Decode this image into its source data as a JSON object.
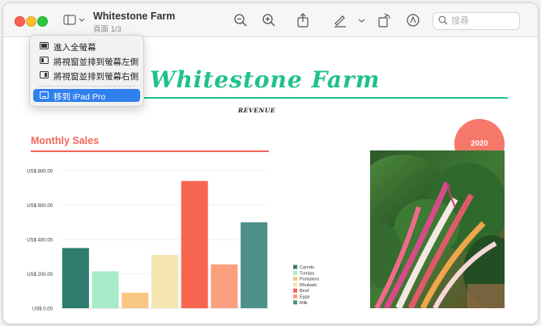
{
  "window": {
    "title": "Whitestone Farm",
    "page_indicator": "頁面 1/3"
  },
  "toolbar": {
    "icons": [
      "sidebar-icon",
      "chevron-down-icon",
      "zoom-out-icon",
      "zoom-in-icon",
      "share-icon",
      "markup-pen-icon",
      "chevron-down-icon",
      "rotate-icon",
      "annotate-icon",
      "search-icon"
    ],
    "search_placeholder": "搜尋"
  },
  "window_menu": {
    "items": [
      {
        "label": "進入全螢幕",
        "icon": "fullscreen-icon"
      },
      {
        "label": "將視窗並排到螢幕左側",
        "icon": "tile-left-icon"
      },
      {
        "label": "將視窗並排到螢幕右側",
        "icon": "tile-right-icon"
      },
      {
        "label": "移到 iPad Pro",
        "icon": "ipad-icon",
        "selected": true
      }
    ]
  },
  "document": {
    "title": "Whitestone Farm",
    "subtitle": "REVENUE",
    "section_title": "Monthly Sales",
    "badge": "2020",
    "photo": "chard-vegetables-photo"
  },
  "colors": {
    "accent_green": "#1fc28a",
    "accent_coral": "#f4655a",
    "badge": "#f6786a",
    "menu_selected": "#2f80ed"
  },
  "chart_data": {
    "type": "bar",
    "categories": [
      "Carrots",
      "Turnips",
      "Pumpkins",
      "Rhubarb",
      "Beef",
      "Eggs",
      "Milk"
    ],
    "values": [
      350,
      215,
      90,
      310,
      740,
      255,
      500
    ],
    "colors": [
      "#2e7d6f",
      "#a8ebc8",
      "#f8c784",
      "#f4e4b0",
      "#f86652",
      "#fba07f",
      "#4c9189"
    ],
    "ylim": [
      0,
      800
    ],
    "yticks": [
      0,
      200,
      400,
      600,
      800
    ],
    "ytick_labels": [
      "US$ 0.00",
      "US$ 200.00",
      "US$ 400.00",
      "US$ 600.00",
      "US$ 800.00"
    ],
    "legend": [
      "Carrots",
      "Turnips",
      "Pumpkins",
      "Rhubarb",
      "Beef",
      "Eggs",
      "Milk"
    ],
    "legend_position": "right",
    "grid": true
  }
}
